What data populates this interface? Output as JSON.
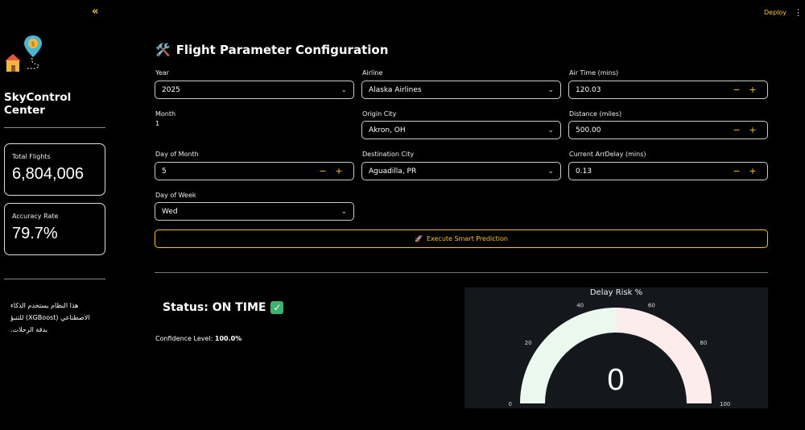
{
  "sidebar": {
    "collapse_icon": "«",
    "brand": "SkyControl Center",
    "metrics": [
      {
        "label": "Total Flights",
        "value": "6,804,006"
      },
      {
        "label": "Accuracy Rate",
        "value": "79.7%"
      }
    ],
    "note": "هذا النظام يستخدم الذكاء الاصطناعي (XGBoost) للتنبؤ بدقة الرحلات."
  },
  "header": {
    "deploy": "Deploy",
    "menu_icon": "⋮"
  },
  "main": {
    "title": "Flight Parameter Configuration",
    "title_icon": "🛠️",
    "fields": {
      "year": {
        "label": "Year",
        "value": "2025"
      },
      "month": {
        "label": "Month",
        "value": "1"
      },
      "day_of_month": {
        "label": "Day of Month",
        "value": "5"
      },
      "day_of_week": {
        "label": "Day of Week",
        "value": "Wed"
      },
      "airline": {
        "label": "Airline",
        "value": "Alaska Airlines"
      },
      "origin": {
        "label": "Origin City",
        "value": "Akron, OH"
      },
      "destination": {
        "label": "Destination City",
        "value": "Aguadilla, PR"
      },
      "air_time": {
        "label": "Air Time (mins)",
        "value": "120.03"
      },
      "distance": {
        "label": "Distance (miles)",
        "value": "500.00"
      },
      "arr_delay": {
        "label": "Current ArrDelay (mins)",
        "value": "0.13"
      }
    },
    "stepper": {
      "minus": "−",
      "plus": "+"
    },
    "execute_icon": "🚀",
    "execute_label": "Execute Smart Prediction",
    "status": "Status: ON TIME",
    "status_icon": "✓",
    "confidence_label": "Confidence Level:",
    "confidence_value": "100.0%"
  },
  "gauge": {
    "title": "Delay Risk %",
    "value": "0",
    "risk": 0,
    "ticks": [
      "0",
      "20",
      "40",
      "60",
      "80",
      "100"
    ],
    "range": [
      0,
      100
    ],
    "colors": {
      "low": "#eaf8ee",
      "high": "#fcecec",
      "panel": "#14171c"
    }
  },
  "colors": {
    "accent": "#f5c518",
    "background": "#000000"
  }
}
